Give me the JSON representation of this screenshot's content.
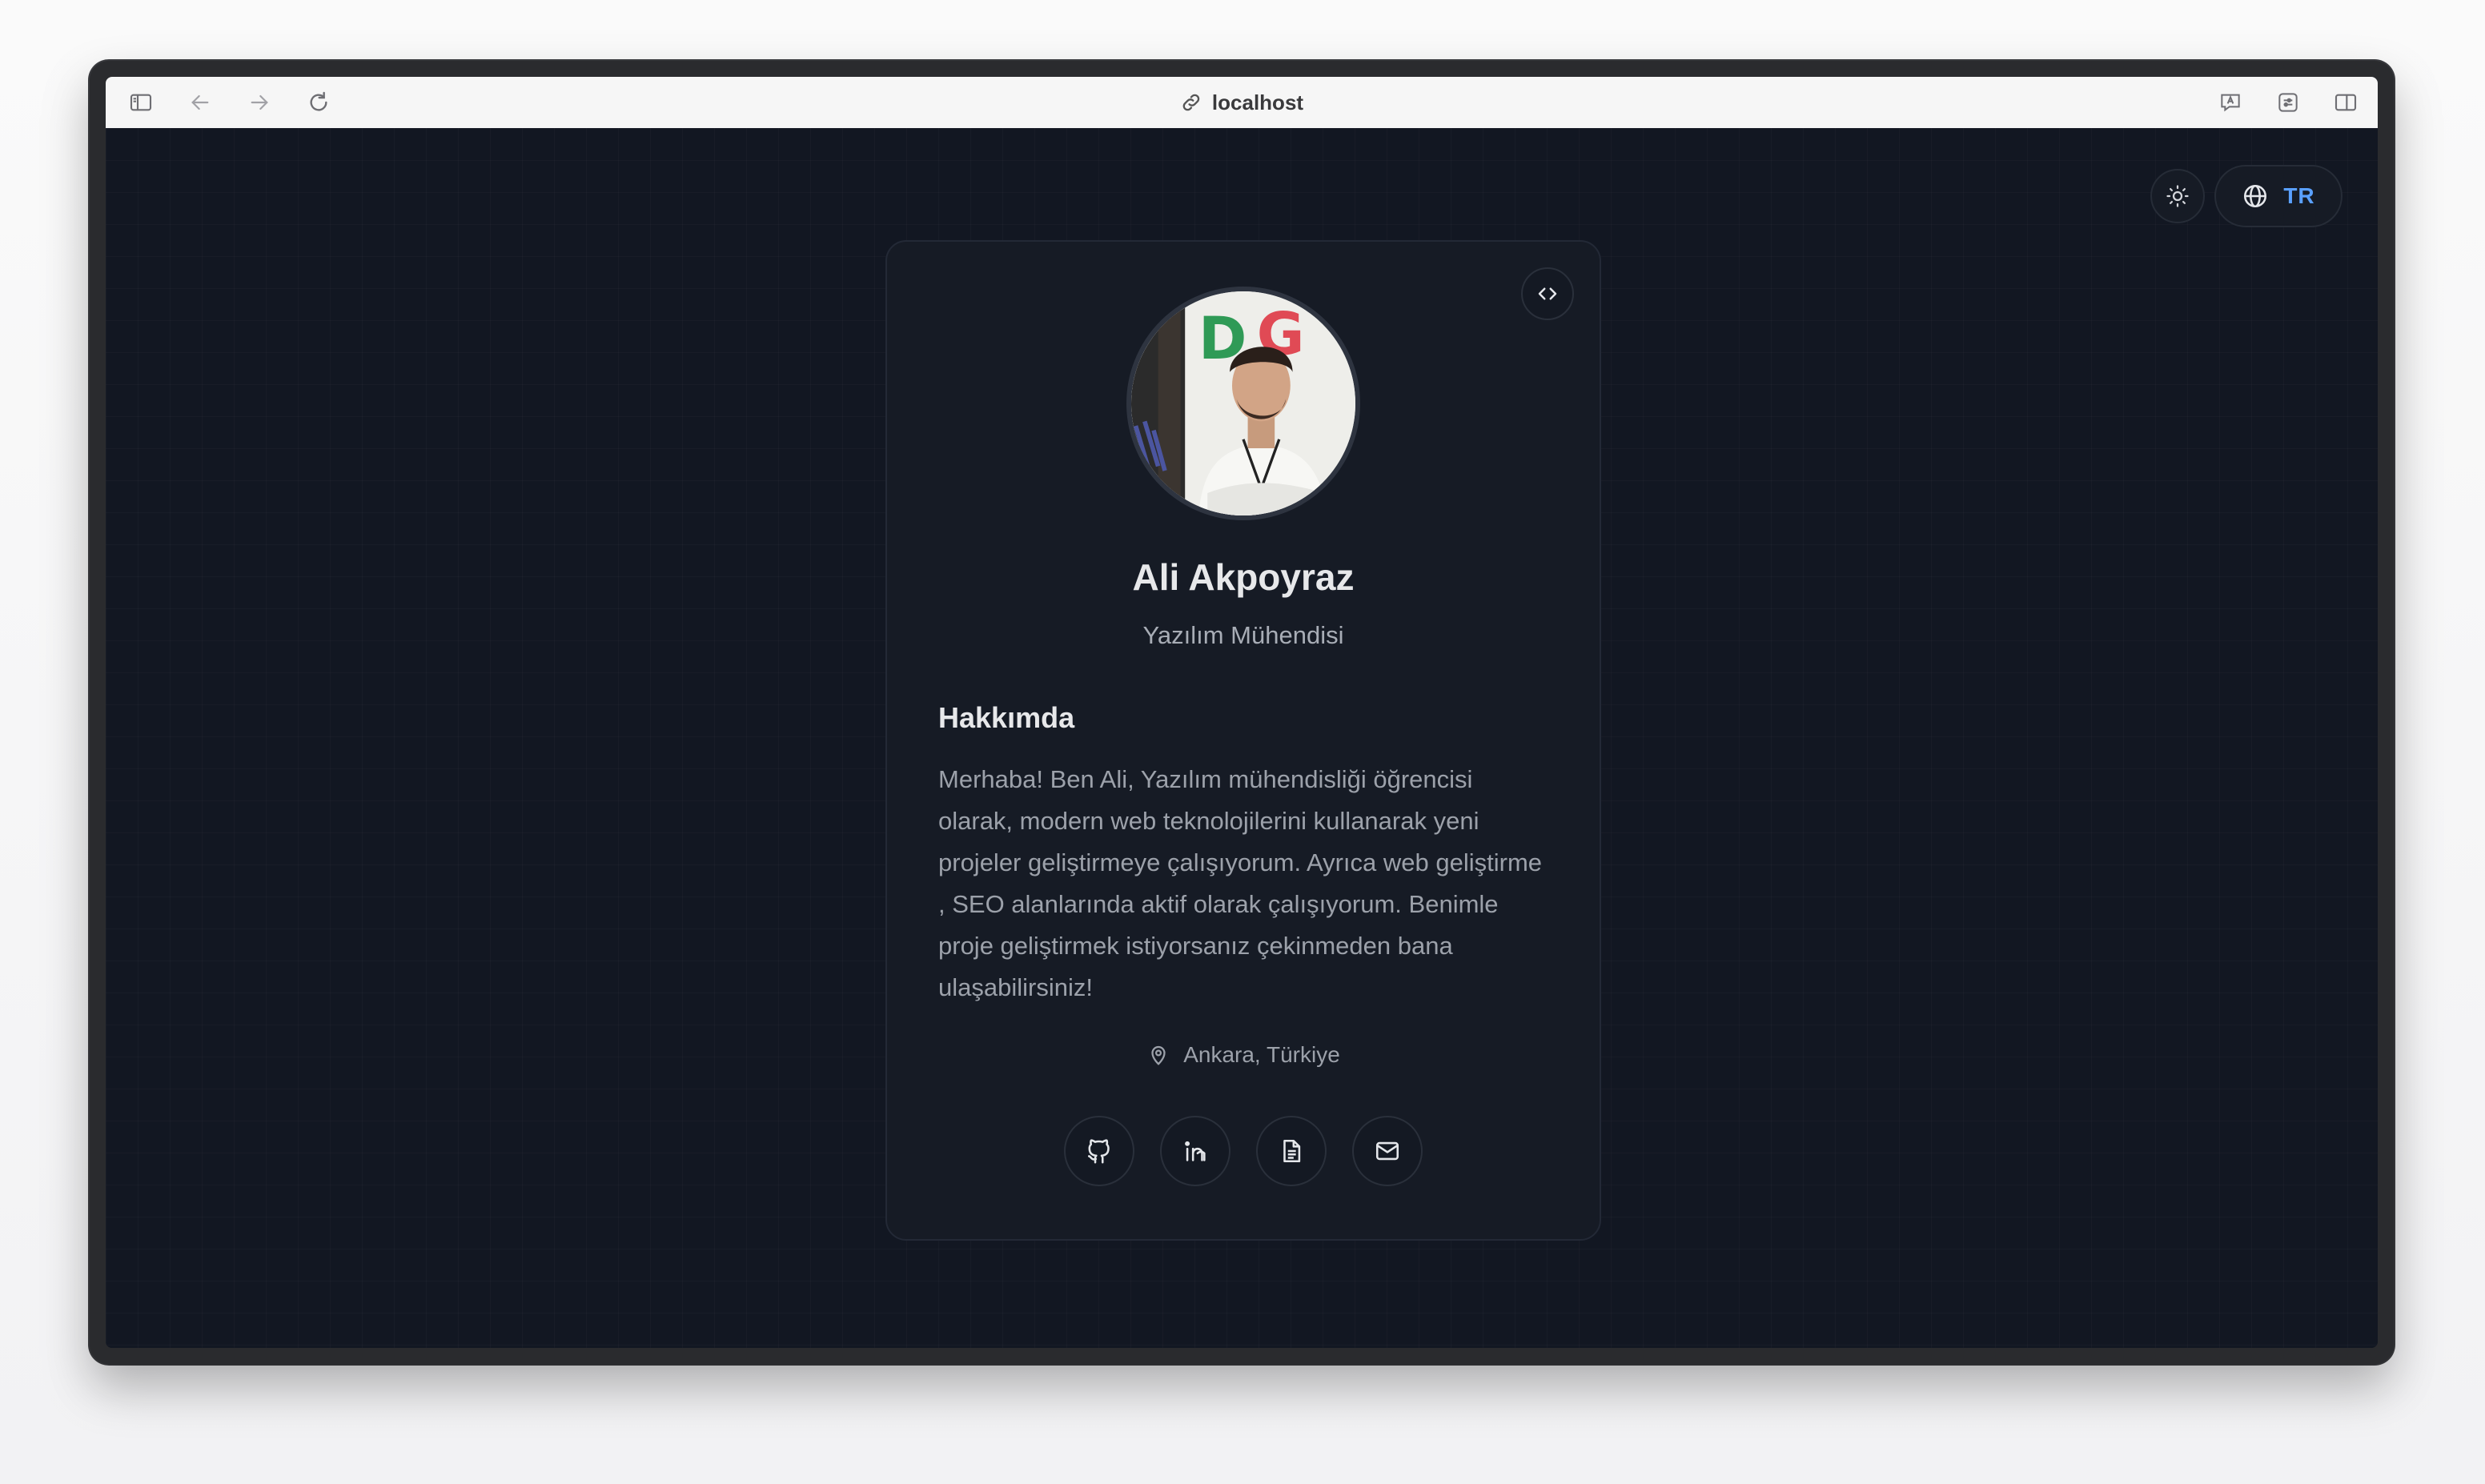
{
  "browser": {
    "address": "localhost"
  },
  "controls": {
    "language_code": "TR"
  },
  "profile": {
    "name": "Ali Akpoyraz",
    "role": "Yazılım Mühendisi",
    "about_title": "Hakkımda",
    "about_text": "Merhaba! Ben Ali, Yazılım mühendisliği öğrencisi olarak, modern web teknolojilerini kullanarak yeni projeler geliştirmeye çalışıyorum. Ayrıca web geliştirme , SEO alanlarında aktif olarak çalışıyorum. Benimle proje geliştirmek istiyorsanız çekinmeden bana ulaşabilirsiniz!",
    "location": "Ankara, Türkiye"
  },
  "socials": [
    {
      "icon": "github-icon"
    },
    {
      "icon": "linkedin-icon"
    },
    {
      "icon": "document-icon"
    },
    {
      "icon": "mail-icon"
    }
  ],
  "colors": {
    "page_bg": "#121722",
    "card_bg": "#161b25",
    "accent": "#5aa0ff"
  }
}
